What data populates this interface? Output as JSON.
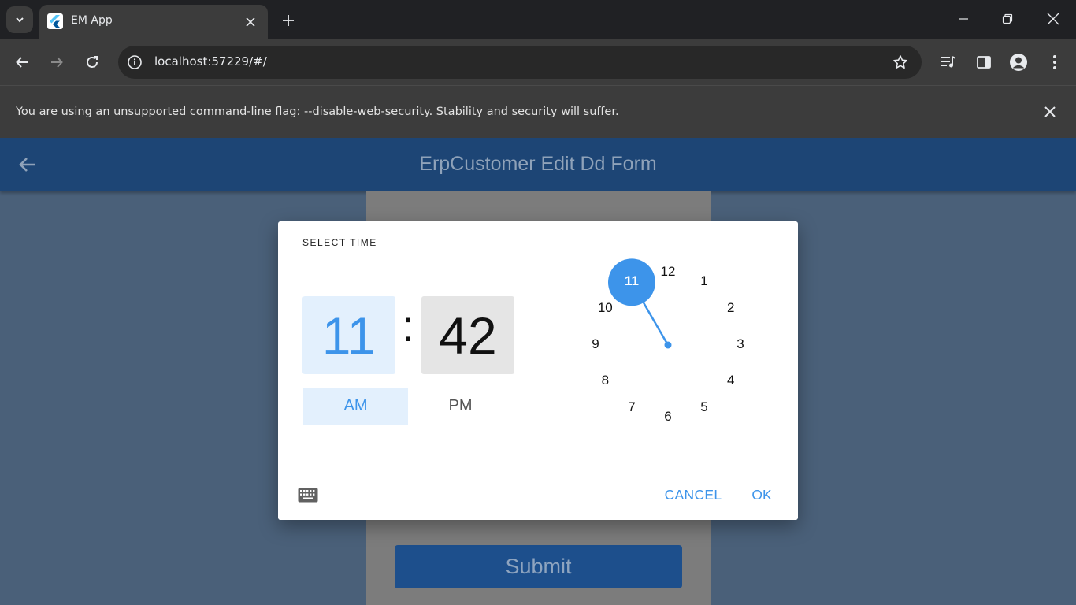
{
  "browser": {
    "tab_title": "EM App",
    "url": "localhost:57229/#/",
    "infobar_message": "You are using an unsupported command-line flag: --disable-web-security. Stability and security will suffer."
  },
  "app": {
    "title": "ErpCustomer Edit Dd Form",
    "submit_label": "Submit"
  },
  "time_picker": {
    "help_text": "SELECT TIME",
    "hour": "11",
    "separator": ":",
    "minute": "42",
    "am_label": "AM",
    "pm_label": "PM",
    "selected_period": "AM",
    "selected_hour": 11,
    "dial_numbers": [
      "12",
      "1",
      "2",
      "3",
      "4",
      "5",
      "6",
      "7",
      "8",
      "9",
      "10",
      "11"
    ],
    "cancel_label": "CANCEL",
    "ok_label": "OK",
    "accent_color": "#3d94ea"
  },
  "icons": {
    "tab_search": "chevron-down-icon",
    "favicon": "flutter-logo-icon",
    "keyboard": "keyboard-icon",
    "back": "arrow-back-icon"
  }
}
